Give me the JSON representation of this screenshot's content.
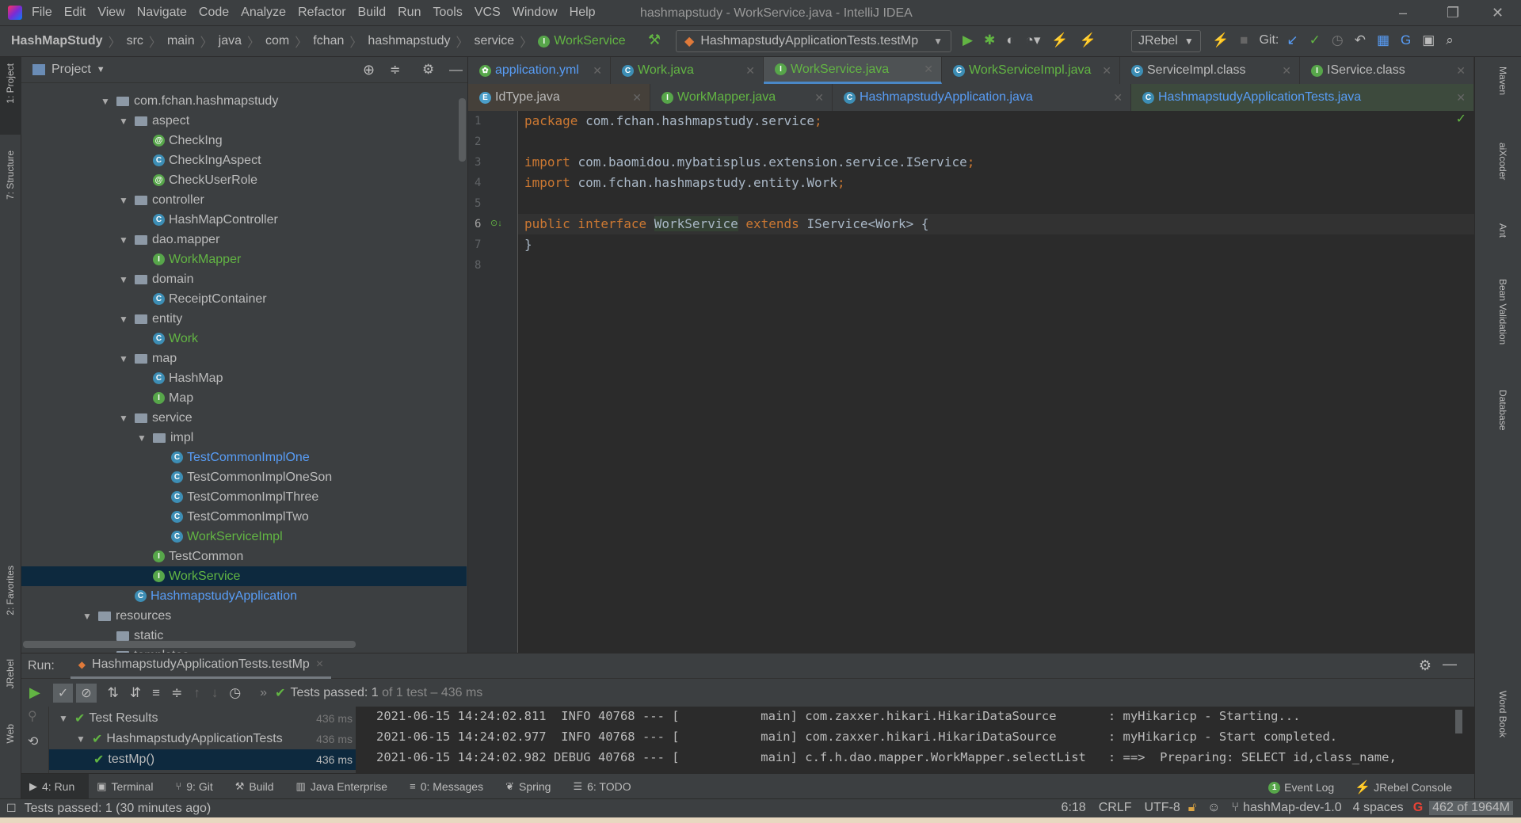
{
  "menu": [
    "File",
    "Edit",
    "View",
    "Navigate",
    "Code",
    "Analyze",
    "Refactor",
    "Build",
    "Run",
    "Tools",
    "VCS",
    "Window",
    "Help"
  ],
  "window_title": "hashmapstudy - WorkService.java - IntelliJ IDEA",
  "breadcrumb": [
    "HashMapStudy",
    "src",
    "main",
    "java",
    "com",
    "fchan",
    "hashmapstudy",
    "service",
    "WorkService"
  ],
  "run_config": "HashmapstudyApplicationTests.testMp",
  "jrebel_label": "JRebel",
  "git_label": "Git:",
  "project_label": "Project",
  "tree": [
    {
      "label": "com.fchan.hashmapstudy",
      "type": "folder",
      "level": 0,
      "open": true
    },
    {
      "label": "aspect",
      "type": "folder",
      "level": 1,
      "open": true
    },
    {
      "label": "CheckIng",
      "type": "annotation",
      "level": 2
    },
    {
      "label": "CheckIngAspect",
      "type": "class",
      "level": 2
    },
    {
      "label": "CheckUserRole",
      "type": "annotation",
      "level": 2
    },
    {
      "label": "controller",
      "type": "folder",
      "level": 1,
      "open": true
    },
    {
      "label": "HashMapController",
      "type": "class",
      "level": 2
    },
    {
      "label": "dao.mapper",
      "type": "folder",
      "level": 1,
      "open": true
    },
    {
      "label": "WorkMapper",
      "type": "interface",
      "level": 2,
      "color": "green"
    },
    {
      "label": "domain",
      "type": "folder",
      "level": 1,
      "open": true
    },
    {
      "label": "ReceiptContainer",
      "type": "class",
      "level": 2
    },
    {
      "label": "entity",
      "type": "folder",
      "level": 1,
      "open": true
    },
    {
      "label": "Work",
      "type": "class",
      "level": 2,
      "color": "green"
    },
    {
      "label": "map",
      "type": "folder",
      "level": 1,
      "open": true
    },
    {
      "label": "HashMap",
      "type": "class",
      "level": 2
    },
    {
      "label": "Map",
      "type": "interface",
      "level": 2
    },
    {
      "label": "service",
      "type": "folder",
      "level": 1,
      "open": true
    },
    {
      "label": "impl",
      "type": "folder",
      "level": 2,
      "open": true
    },
    {
      "label": "TestCommonImplOne",
      "type": "class",
      "level": 3,
      "color": "blue"
    },
    {
      "label": "TestCommonImplOneSon",
      "type": "class",
      "level": 3
    },
    {
      "label": "TestCommonImplThree",
      "type": "class",
      "level": 3
    },
    {
      "label": "TestCommonImplTwo",
      "type": "class",
      "level": 3
    },
    {
      "label": "WorkServiceImpl",
      "type": "class",
      "level": 3,
      "color": "green"
    },
    {
      "label": "TestCommon",
      "type": "interface",
      "level": 2
    },
    {
      "label": "WorkService",
      "type": "interface",
      "level": 2,
      "color": "green",
      "selected": true
    },
    {
      "label": "HashmapstudyApplication",
      "type": "class",
      "level": 1,
      "color": "blue"
    },
    {
      "label": "resources",
      "type": "folder",
      "level": -1,
      "open": true
    },
    {
      "label": "static",
      "type": "folder",
      "level": 0
    },
    {
      "label": "templates",
      "type": "folder",
      "level": 0
    }
  ],
  "tabs_row1": [
    {
      "label": "application.yml",
      "icon": "yml",
      "color": "blue"
    },
    {
      "label": "Work.java",
      "icon": "C",
      "color": "green"
    },
    {
      "label": "WorkService.java",
      "icon": "I",
      "color": "green",
      "active": true
    },
    {
      "label": "WorkServiceImpl.java",
      "icon": "C",
      "color": "green"
    },
    {
      "label": "ServiceImpl.class",
      "icon": "C",
      "color": "default"
    },
    {
      "label": "IService.class",
      "icon": "I",
      "color": "default"
    }
  ],
  "tabs_row2": [
    {
      "label": "IdType.java",
      "icon": "E",
      "color": "default"
    },
    {
      "label": "WorkMapper.java",
      "icon": "I",
      "color": "green"
    },
    {
      "label": "HashmapstudyApplication.java",
      "icon": "C",
      "color": "blue"
    },
    {
      "label": "HashmapstudyApplicationTests.java",
      "icon": "C",
      "color": "blue"
    }
  ],
  "code_lines": [
    [
      {
        "t": "package ",
        "k": 1
      },
      {
        "t": "com.fchan.hashmapstudy.service"
      },
      {
        "t": ";",
        "k": 1
      }
    ],
    [],
    [
      {
        "t": "import ",
        "k": 1
      },
      {
        "t": "com.baomidou.mybatisplus.extension.service.IService"
      },
      {
        "t": ";",
        "k": 1
      }
    ],
    [
      {
        "t": "import ",
        "k": 1
      },
      {
        "t": "com.fchan.hashmapstudy.entity.Work"
      },
      {
        "t": ";",
        "k": 1
      }
    ],
    [],
    [
      {
        "t": "public interface ",
        "k": 1
      },
      {
        "t": "WorkService"
      },
      {
        "t": " extends ",
        "k": 1
      },
      {
        "t": "IService<Work> {"
      }
    ],
    [
      {
        "t": "}"
      }
    ],
    []
  ],
  "run": {
    "label": "Run:",
    "tab": "HashmapstudyApplicationTests.testMp",
    "status_prefix": "Tests passed: ",
    "status_count": "1",
    "status_suffix": " of 1 test – 436 ms",
    "tests": [
      {
        "label": "Test Results",
        "time": "436 ms"
      },
      {
        "label": "HashmapstudyApplicationTests",
        "time": "436 ms"
      },
      {
        "label": "testMp()",
        "time": "436 ms"
      }
    ],
    "console": [
      "2021-06-15 14:24:02.811  INFO 40768 --- [           main] com.zaxxer.hikari.HikariDataSource       : myHikaricp - Starting...",
      "2021-06-15 14:24:02.977  INFO 40768 --- [           main] com.zaxxer.hikari.HikariDataSource       : myHikaricp - Start completed.",
      "2021-06-15 14:24:02.982 DEBUG 40768 --- [           main] c.f.h.dao.mapper.WorkMapper.selectList   : ==>  Preparing: SELECT id,class_name,"
    ]
  },
  "tool_tabs": [
    "4: Run",
    "Terminal",
    "9: Git",
    "Build",
    "Java Enterprise",
    "0: Messages",
    "Spring",
    "6: TODO"
  ],
  "event_log": "Event Log",
  "event_count": "1",
  "jrebel_console": "JRebel Console",
  "left_tools": [
    "1: Project",
    "7: Structure",
    "2: Favorites",
    "JRebel",
    "Web"
  ],
  "right_tools": [
    "Maven",
    "aiXcoder",
    "Ant",
    "Bean Validation",
    "Database",
    "Word Book"
  ],
  "status": {
    "message": "Tests passed: 1 (30 minutes ago)",
    "position": "6:18",
    "line_sep": "CRLF",
    "encoding": "UTF-8",
    "branch": "hashMap-dev-1.0",
    "indent": "4 spaces",
    "memory": "462 of 1964M"
  },
  "colors": {
    "accent": "#4a88c7",
    "green": "#62b543",
    "keyword": "#cc7832",
    "editor_bg": "#2b2b2b"
  }
}
